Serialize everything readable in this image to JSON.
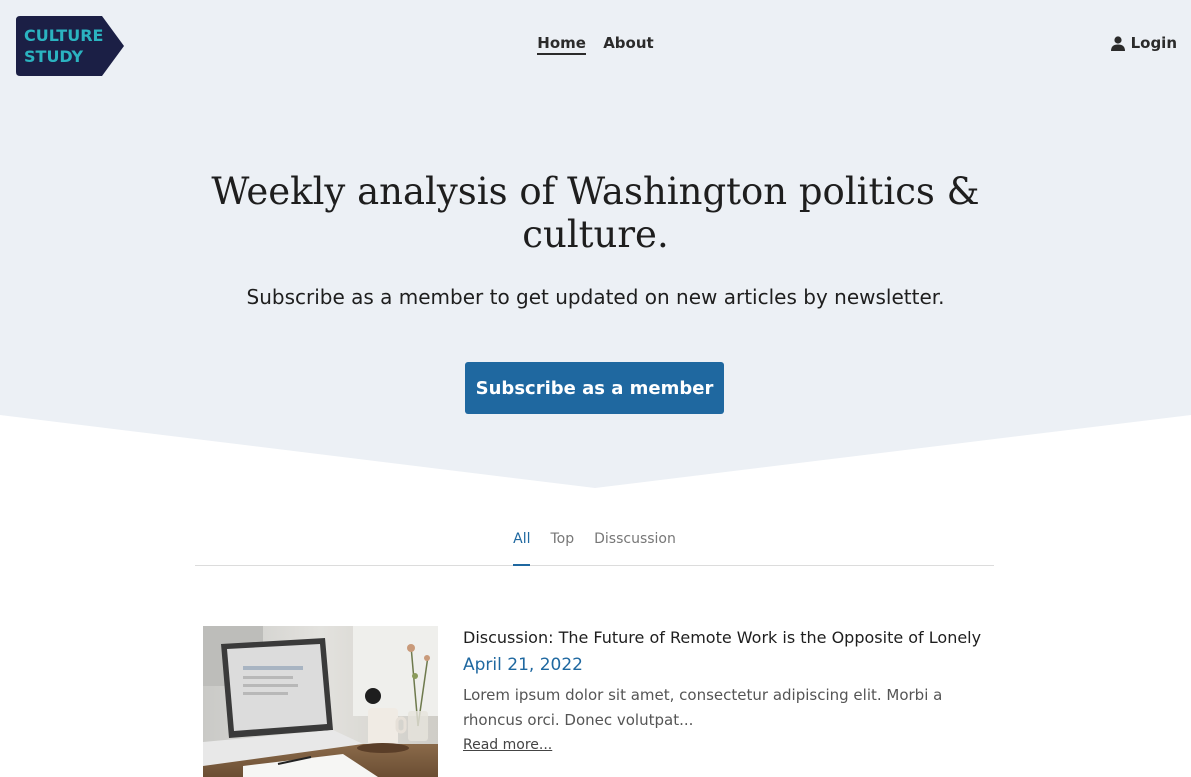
{
  "header": {
    "logo_line1": "CULTURE",
    "logo_line2": "STUDY",
    "nav": [
      {
        "label": "Home",
        "active": true
      },
      {
        "label": "About",
        "active": false
      }
    ],
    "login_label": "Login",
    "login_icon": "user-icon"
  },
  "hero": {
    "title_line1": "Weekly analysis of Washington politics &",
    "title_line2": "culture.",
    "subtitle": "Subscribe as a member to get updated on new articles by newsletter.",
    "cta_label": "Subscribe as a member"
  },
  "tabs": [
    {
      "label": "All",
      "active": true
    },
    {
      "label": "Top",
      "active": false
    },
    {
      "label": "Disscussion",
      "active": false
    }
  ],
  "posts": [
    {
      "title": "Discussion: The Future of Remote Work is the Opposite of Lonely",
      "date": "April 21, 2022",
      "excerpt": "Lorem ipsum dolor sit amet, consectetur adipiscing elit. Morbi a rhoncus orci. Donec volutpat...",
      "read_more": "Read more..."
    }
  ],
  "colors": {
    "hero_bg": "#ecf0f5",
    "accent": "#1f68a0",
    "logo_bg": "#1b1f45",
    "logo_text": "#2bb3c0"
  }
}
